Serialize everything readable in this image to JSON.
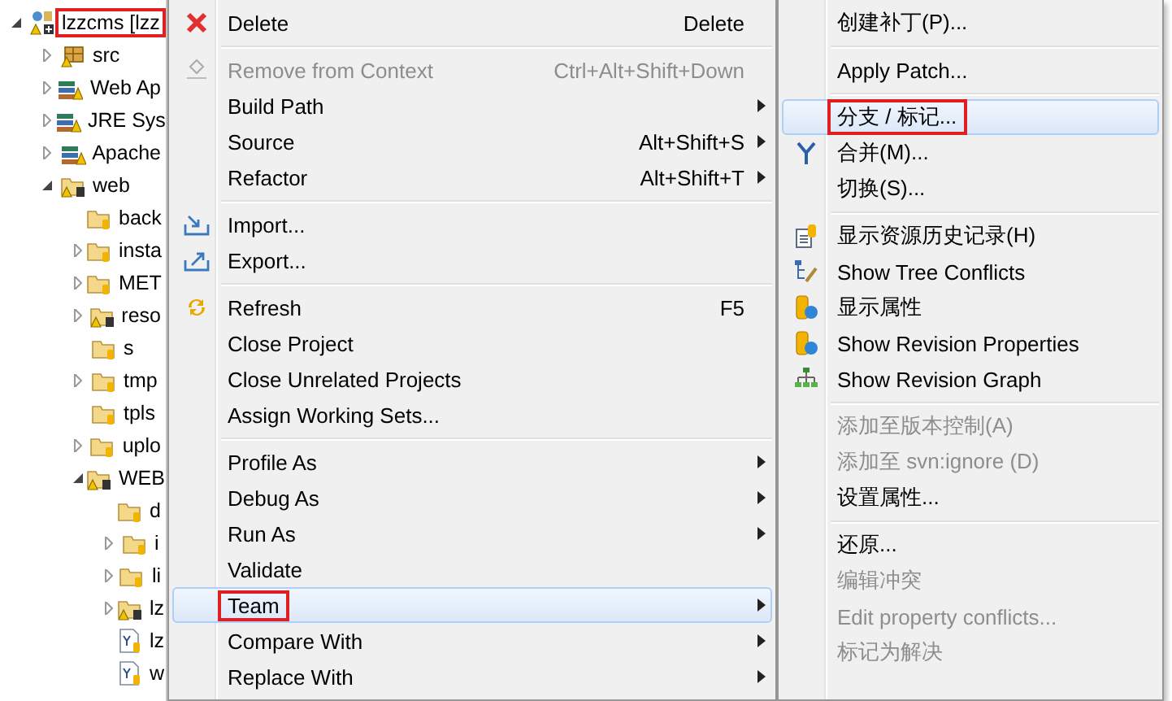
{
  "tree": {
    "items": [
      {
        "label": "lzzcms [lzz",
        "kind": "project",
        "expanded": true,
        "marked": true,
        "children": [
          {
            "label": "src",
            "kind": "package",
            "expanded": false
          },
          {
            "label": "Web Ap",
            "kind": "library",
            "expanded": false
          },
          {
            "label": "JRE Sys",
            "kind": "library",
            "expanded": false
          },
          {
            "label": "Apache",
            "kind": "library",
            "expanded": false
          },
          {
            "label": "web",
            "kind": "webfolder",
            "expanded": true,
            "children": [
              {
                "label": "back",
                "kind": "folder"
              },
              {
                "label": "insta",
                "kind": "folder",
                "expanded": false
              },
              {
                "label": "MET",
                "kind": "folder",
                "expanded": false
              },
              {
                "label": "reso",
                "kind": "warnfolder",
                "expanded": false
              },
              {
                "label": "s",
                "kind": "folder"
              },
              {
                "label": "tmp",
                "kind": "folder",
                "expanded": false
              },
              {
                "label": "tpls",
                "kind": "folder"
              },
              {
                "label": "uplo",
                "kind": "folder",
                "expanded": false
              },
              {
                "label": "WEB",
                "kind": "warnfolder",
                "expanded": true,
                "children": [
                  {
                    "label": "d",
                    "kind": "folder"
                  },
                  {
                    "label": "i",
                    "kind": "folder",
                    "expanded": false
                  },
                  {
                    "label": "li",
                    "kind": "folder",
                    "expanded": false
                  },
                  {
                    "label": "lz",
                    "kind": "warnfolder",
                    "expanded": false
                  },
                  {
                    "label": "lz",
                    "kind": "file"
                  },
                  {
                    "label": "w",
                    "kind": "file"
                  }
                ]
              }
            ]
          }
        ]
      }
    ]
  },
  "menus": [
    {
      "items": [
        {
          "kind": "delete",
          "label": "Delete",
          "shortcut": "Delete",
          "submenu": false,
          "disabled": false,
          "selected": false,
          "marked": false
        },
        {
          "kind": "separator"
        },
        {
          "kind": "remove",
          "label": "Remove from Context",
          "shortcut": "Ctrl+Alt+Shift+Down",
          "submenu": false,
          "disabled": true,
          "selected": false,
          "marked": false
        },
        {
          "kind": "plain",
          "label": "Build Path",
          "submenu": true,
          "disabled": false,
          "selected": false,
          "marked": false
        },
        {
          "kind": "plain",
          "label": "Source",
          "shortcut": "Alt+Shift+S",
          "submenu": true,
          "disabled": false,
          "selected": false,
          "marked": false
        },
        {
          "kind": "plain",
          "label": "Refactor",
          "shortcut": "Alt+Shift+T",
          "submenu": true,
          "disabled": false,
          "selected": false,
          "marked": false
        },
        {
          "kind": "separator"
        },
        {
          "kind": "import",
          "label": "Import...",
          "submenu": false,
          "disabled": false,
          "selected": false,
          "marked": false
        },
        {
          "kind": "export",
          "label": "Export...",
          "submenu": false,
          "disabled": false,
          "selected": false,
          "marked": false
        },
        {
          "kind": "separator"
        },
        {
          "kind": "refresh",
          "label": "Refresh",
          "shortcut": "F5",
          "submenu": false,
          "disabled": false,
          "selected": false,
          "marked": false
        },
        {
          "kind": "plain",
          "label": "Close Project",
          "submenu": false,
          "disabled": false,
          "selected": false,
          "marked": false
        },
        {
          "kind": "plain",
          "label": "Close Unrelated Projects",
          "submenu": false,
          "disabled": false,
          "selected": false,
          "marked": false
        },
        {
          "kind": "plain",
          "label": "Assign Working Sets...",
          "submenu": false,
          "disabled": false,
          "selected": false,
          "marked": false
        },
        {
          "kind": "separator"
        },
        {
          "kind": "plain",
          "label": "Profile As",
          "submenu": true,
          "disabled": false,
          "selected": false,
          "marked": false
        },
        {
          "kind": "plain",
          "label": "Debug As",
          "submenu": true,
          "disabled": false,
          "selected": false,
          "marked": false
        },
        {
          "kind": "plain",
          "label": "Run As",
          "submenu": true,
          "disabled": false,
          "selected": false,
          "marked": false
        },
        {
          "kind": "plain",
          "label": "Validate",
          "submenu": false,
          "disabled": false,
          "selected": false,
          "marked": false
        },
        {
          "kind": "plain",
          "label": "Team",
          "submenu": true,
          "disabled": false,
          "selected": true,
          "marked": true
        },
        {
          "kind": "plain",
          "label": "Compare With",
          "submenu": true,
          "disabled": false,
          "selected": false,
          "marked": false
        },
        {
          "kind": "plain",
          "label": "Replace With",
          "submenu": true,
          "disabled": false,
          "selected": false,
          "marked": false
        }
      ]
    },
    {
      "items": [
        {
          "kind": "plain",
          "label": "创建补丁(P)...",
          "submenu": false,
          "disabled": false,
          "selected": false,
          "marked": false
        },
        {
          "kind": "separator"
        },
        {
          "kind": "plain",
          "label": "Apply Patch...",
          "submenu": false,
          "disabled": false,
          "selected": false,
          "marked": false
        },
        {
          "kind": "separator"
        },
        {
          "kind": "plain",
          "label": "分支 / 标记...",
          "submenu": false,
          "disabled": false,
          "selected": true,
          "marked": true
        },
        {
          "kind": "merge",
          "label": "合并(M)...",
          "submenu": false,
          "disabled": false,
          "selected": false,
          "marked": false
        },
        {
          "kind": "plain",
          "label": "切换(S)...",
          "submenu": false,
          "disabled": false,
          "selected": false,
          "marked": false
        },
        {
          "kind": "separator"
        },
        {
          "kind": "history",
          "label": "显示资源历史记录(H)",
          "submenu": false,
          "disabled": false,
          "selected": false,
          "marked": false
        },
        {
          "kind": "conflicts",
          "label": "Show Tree Conflicts",
          "submenu": false,
          "disabled": false,
          "selected": false,
          "marked": false
        },
        {
          "kind": "properties",
          "label": "显示属性",
          "submenu": false,
          "disabled": false,
          "selected": false,
          "marked": false
        },
        {
          "kind": "properties",
          "label": "Show Revision Properties",
          "submenu": false,
          "disabled": false,
          "selected": false,
          "marked": false
        },
        {
          "kind": "graph",
          "label": "Show Revision Graph",
          "submenu": false,
          "disabled": false,
          "selected": false,
          "marked": false
        },
        {
          "kind": "separator"
        },
        {
          "kind": "plain",
          "label": "添加至版本控制(A)",
          "submenu": false,
          "disabled": true,
          "selected": false,
          "marked": false
        },
        {
          "kind": "plain",
          "label": "添加至 svn:ignore (D)",
          "submenu": false,
          "disabled": true,
          "selected": false,
          "marked": false
        },
        {
          "kind": "plain",
          "label": "设置属性...",
          "submenu": false,
          "disabled": false,
          "selected": false,
          "marked": false
        },
        {
          "kind": "separator"
        },
        {
          "kind": "plain",
          "label": "还原...",
          "submenu": false,
          "disabled": false,
          "selected": false,
          "marked": false
        },
        {
          "kind": "plain",
          "label": "编辑冲突",
          "submenu": false,
          "disabled": true,
          "selected": false,
          "marked": false
        },
        {
          "kind": "plain",
          "label": "Edit property conflicts...",
          "submenu": false,
          "disabled": true,
          "selected": false,
          "marked": false
        },
        {
          "kind": "plain",
          "label": "标记为解决",
          "submenu": false,
          "disabled": true,
          "selected": false,
          "marked": false
        }
      ]
    }
  ]
}
